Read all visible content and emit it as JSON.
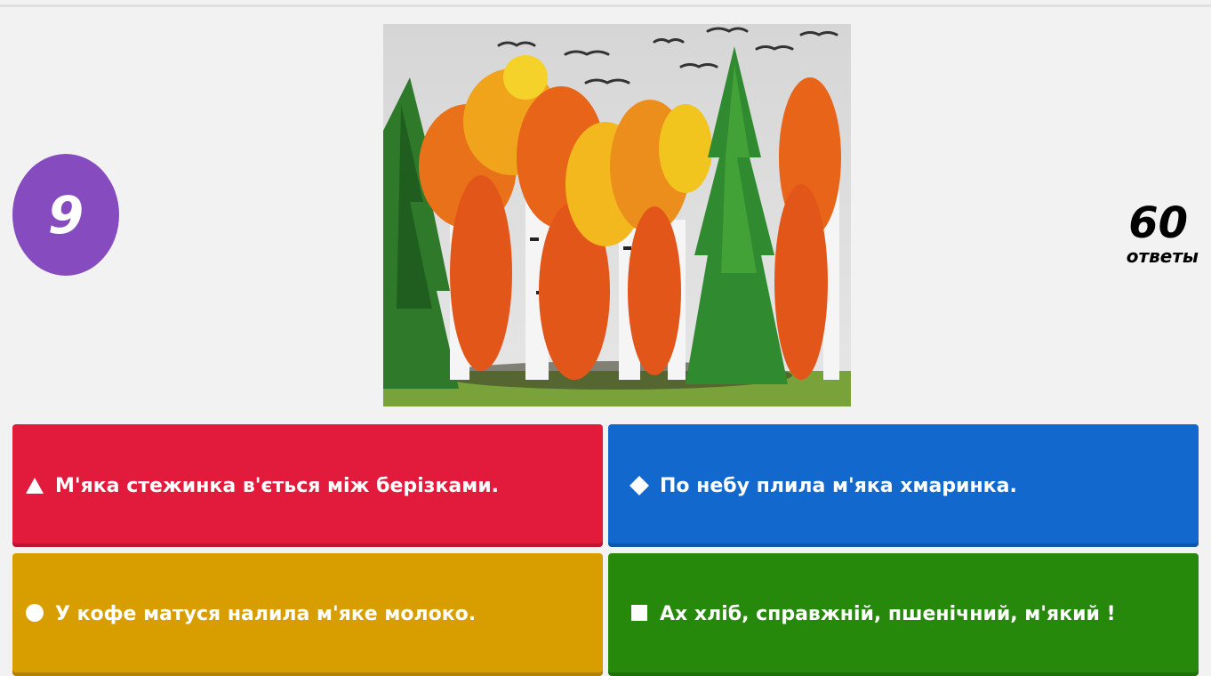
{
  "quiz": {
    "question_number": "9",
    "answers_count": "60",
    "answers_label": "ответы"
  },
  "question_image": {
    "subject": "painting-autumn-birches-and-firs"
  },
  "answers": [
    {
      "color": "#e21b3c",
      "shape": "triangle-icon",
      "text": "М'яка стежинка в'ється між берізками."
    },
    {
      "color": "#1368ce",
      "shape": "diamond-icon",
      "text": "По небу плила м'яка хмаринка."
    },
    {
      "color": "#d89e00",
      "shape": "circle-icon",
      "text": "У кофе матуся налила м'яке молоко."
    },
    {
      "color": "#26890c",
      "shape": "square-icon",
      "text": "Ах хліб, справжній, пшенічний, м'який !"
    }
  ],
  "colors": {
    "background": "#f2f2f2",
    "timer_badge": "#864cbf",
    "answer_text": "#ffffff"
  }
}
